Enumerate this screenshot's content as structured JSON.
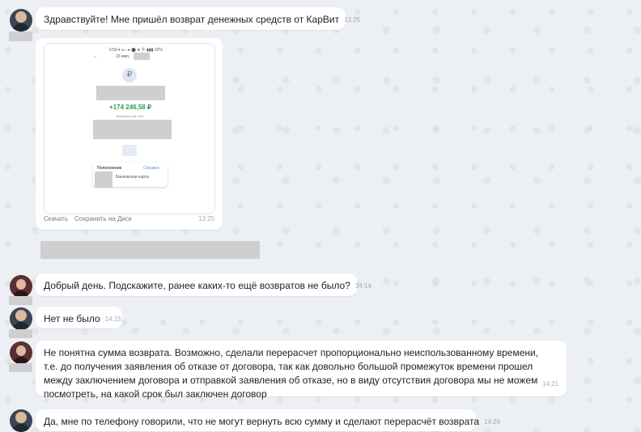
{
  "messages": [
    {
      "text": "Здравствуйте! Мне пришёл возврат денежных средств от КарВит",
      "time": "13:25"
    },
    {
      "text": "Добрый день. Подскажите, ранее каких-то ещё возвратов не было?",
      "time": "14:14"
    },
    {
      "text": "Нет не было",
      "time": "14:15"
    },
    {
      "text": "Не понятна сумма возврата. Возможно, сделали перерасчет пропорционально неиспользованному времени, т.е. до получения заявления об отказе от договора, так как довольно большой промежуток времени прошел между заключением договора и отправкой заявления об отказе, но в виду отсутствия договора мы не можем посмотреть, на какой срок был заключен договор",
      "time": "14:21"
    },
    {
      "text": "Да, мне по телефону говорили, что не могут вернуть всю сумму и сделают перерасчёт возврата",
      "time": "14:26"
    }
  ],
  "attachment": {
    "status_bar": "5:50 ▾ ◂ ⌂ ▸ ⬤ ⊕ Ⓡ ▮▮▮ 32%",
    "back": "←",
    "date": "15 мая,",
    "rub_symbol": "₽",
    "amount": "+174 246,58 ₽",
    "caption": "Зачислено на счёт",
    "card_title": "Пополнение",
    "card_right": "Справка",
    "card_sub": "Банковская карта",
    "time": "13:25",
    "actions": [
      "Скачать",
      "Сохранить на Диск"
    ]
  },
  "colors": {
    "background": "#eceff3",
    "bubble": "#ffffff",
    "amount": "#2e9b4b",
    "time": "#a6abb1"
  }
}
